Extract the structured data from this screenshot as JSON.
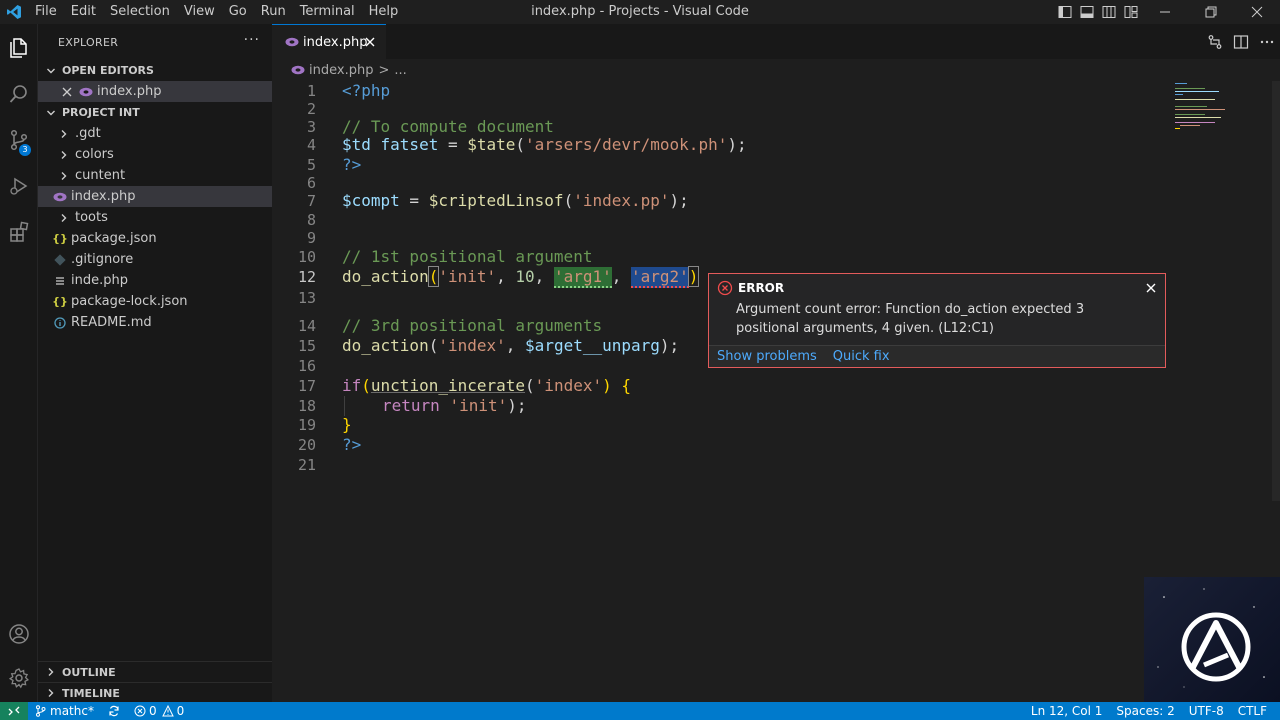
{
  "window": {
    "title": "index.php - Projects - Visual Code"
  },
  "menu": [
    "File",
    "Edit",
    "Selection",
    "View",
    "Go",
    "Run",
    "Terminal",
    "Help"
  ],
  "activity": {
    "scm_badge": "3"
  },
  "sidebar": {
    "title": "EXPLORER",
    "more": "···",
    "open_editors": {
      "header": "OPEN EDITORS",
      "items": [
        {
          "label": "index.php"
        }
      ]
    },
    "project": {
      "header": "PROJECT INT",
      "items": [
        {
          "label": ".gdt",
          "type": "folder"
        },
        {
          "label": "colors",
          "type": "folder"
        },
        {
          "label": "cuntent",
          "type": "folder"
        },
        {
          "label": "index.php",
          "type": "php"
        },
        {
          "label": "toots",
          "type": "folder"
        },
        {
          "label": "package.json",
          "type": "json"
        },
        {
          "label": ".gitignore",
          "type": "git"
        },
        {
          "label": "inde.php",
          "type": "file"
        },
        {
          "label": "package-lock.json",
          "type": "json"
        },
        {
          "label": "README.md",
          "type": "info"
        }
      ]
    },
    "outline": "OUTLINE",
    "timeline": "TIMELINE"
  },
  "tabs": [
    {
      "label": "index.php"
    }
  ],
  "breadcrumb": {
    "file": "index.php",
    "sep": ">",
    "more": "..."
  },
  "editor": {
    "current_line": 12,
    "line_numbers": [
      "1",
      "2",
      "3",
      "4",
      "5",
      "6",
      "7",
      "8",
      "9",
      "10",
      "11",
      "12",
      "13",
      "14",
      "15",
      "16",
      "17",
      "18",
      "19",
      "20",
      "21"
    ],
    "code": {
      "l1": "<?php",
      "l3": "// To compute document",
      "l4_var": "$td fatset",
      "l4_eq": " = ",
      "l4_fn": "$tate",
      "l4_open": "(",
      "l4_str": "'arsers/devr/mook.ph'",
      "l4_close": ");",
      "l5": "?>",
      "l7_var": "$compt",
      "l7_eq": " = ",
      "l7_fn": "$criptedLinsof",
      "l7_open": "(",
      "l7_str": "'index.pp'",
      "l7_close": ");",
      "l10": "// 1st positional argument",
      "l12_fn": "do_action",
      "l12_open": "(",
      "l12_s1": "'init'",
      "l12_c1": ", ",
      "l12_num": "10",
      "l12_c2": ", ",
      "l12_s2": "'arg1'",
      "l12_c3": ", ",
      "l12_s3": "'arg2'",
      "l12_close": ")",
      "l14": "// 3rd positional arguments",
      "l15_fn": "do_action",
      "l15_open": "(",
      "l15_str": "'index'",
      "l15_c": ", ",
      "l15_var": "$arget__unparg",
      "l15_close": ");",
      "l17_kw": "if",
      "l17_open": "(",
      "l17_fn": "unction_incerate",
      "l17_p": "(",
      "l17_str": "'index'",
      "l17_close": ") {",
      "l18_kw": "return",
      "l18_sp": " ",
      "l18_str": "'init'",
      "l18_close": ");",
      "l19": "}",
      "l20": "?>"
    }
  },
  "error_popup": {
    "title": "ERROR",
    "message": "Argument count error: Function do_action expected 3 positional arguments, 4 given. (L12:C1)",
    "actions": [
      "Show problems",
      "Quick fix"
    ],
    "color": "#e35b5b"
  },
  "statusbar": {
    "branch": "mathc*",
    "errors": "0",
    "warnings": "0",
    "position": "Ln 12, Col 1",
    "spaces": "Spaces: 2",
    "encoding": "UTF-8",
    "eol": "CTLF",
    "color": "#007acc"
  }
}
